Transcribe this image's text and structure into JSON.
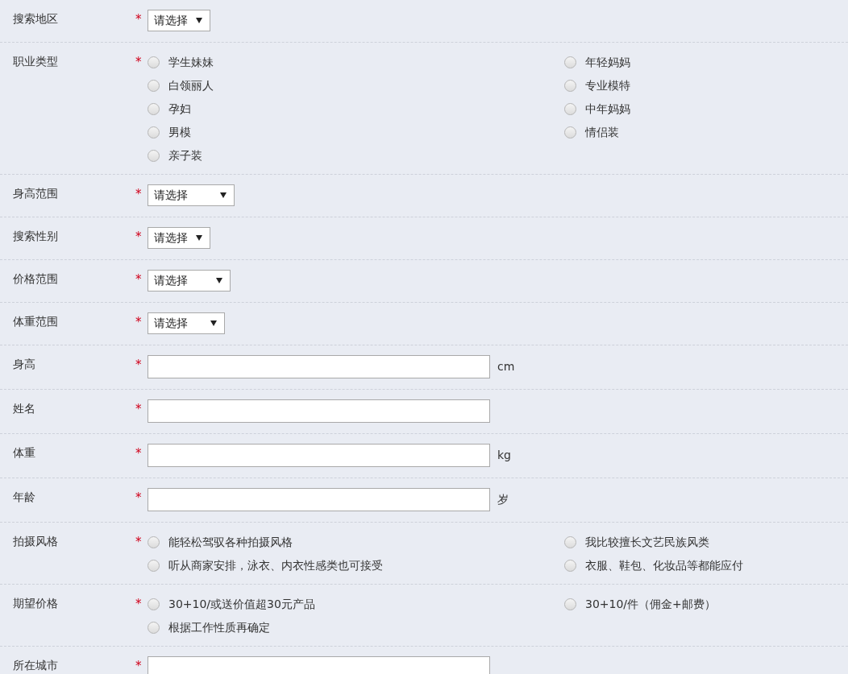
{
  "form": {
    "rows": [
      {
        "kind": "select",
        "label": "搜索地区",
        "required": "*",
        "value": "请选择"
      },
      {
        "kind": "radio",
        "label": "职业类型",
        "required": "*",
        "options": [
          {
            "label": "学生妹妹",
            "selected": false
          },
          {
            "label": "年轻妈妈",
            "selected": false
          },
          {
            "label": "白领丽人",
            "selected": false
          },
          {
            "label": "专业模特",
            "selected": false
          },
          {
            "label": "孕妇",
            "selected": false
          },
          {
            "label": "中年妈妈",
            "selected": false
          },
          {
            "label": "男模",
            "selected": false
          },
          {
            "label": "情侣装",
            "selected": false
          },
          {
            "label": "亲子装",
            "selected": false
          }
        ]
      },
      {
        "kind": "select",
        "label": "身高范围",
        "required": "*",
        "value": "请选择"
      },
      {
        "kind": "select",
        "label": "搜索性别",
        "required": "*",
        "value": "请选择"
      },
      {
        "kind": "select",
        "label": "价格范围",
        "required": "*",
        "value": "请选择"
      },
      {
        "kind": "select",
        "label": "体重范围",
        "required": "*",
        "value": "请选择"
      },
      {
        "kind": "text",
        "label": "身高",
        "required": "*",
        "unit": "cm"
      },
      {
        "kind": "text",
        "label": "姓名",
        "required": "*"
      },
      {
        "kind": "text",
        "label": "体重",
        "required": "*",
        "unit": "kg"
      },
      {
        "kind": "text",
        "label": "年龄",
        "required": "*",
        "unit": "岁"
      },
      {
        "kind": "radio",
        "label": "拍摄风格",
        "required": "*",
        "options": [
          {
            "label": "能轻松驾驭各种拍摄风格",
            "selected": false
          },
          {
            "label": "我比较擅长文艺民族风类",
            "selected": false
          },
          {
            "label": "听从商家安排，泳衣、内衣性感类也可接受",
            "selected": false
          },
          {
            "label": "衣服、鞋包、化妆品等都能应付",
            "selected": false
          }
        ]
      },
      {
        "kind": "radio",
        "label": "期望价格",
        "required": "*",
        "options": [
          {
            "label": "30+10/或送价值超30元产品",
            "selected": false
          },
          {
            "label": "30+10/件（佣金+邮费）",
            "selected": false
          },
          {
            "label": "根据工作性质再确定",
            "selected": false
          }
        ]
      },
      {
        "kind": "text",
        "label": "所在城市",
        "required": "*"
      }
    ]
  }
}
